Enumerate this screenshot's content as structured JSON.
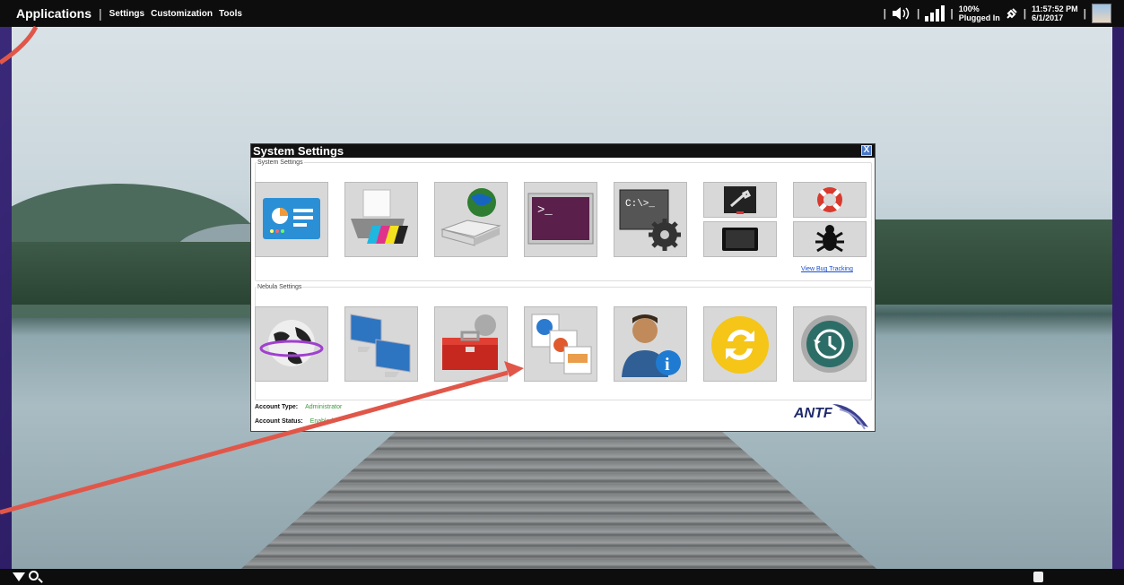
{
  "topbar": {
    "apps_label": "Applications",
    "separator": "|",
    "menu": [
      "Settings",
      "Customization",
      "Tools"
    ],
    "volume_icon": "speaker-icon",
    "battery_percent": "100%",
    "battery_status": "Plugged In",
    "time": "11:57:52 PM",
    "date": "6/1/2017"
  },
  "window": {
    "title": "System Settings",
    "close_label": "X",
    "system_group_label": "System Settings",
    "nebula_group_label": "Nebula Settings",
    "bug_link": "View Bug Tracking",
    "system_tiles": [
      "display-card-icon",
      "printer-icon",
      "network-router-icon",
      "terminal-icon",
      "command-gear-icon"
    ],
    "system_minis": [
      "tools-icon",
      "tablet-icon",
      "lifebuoy-icon",
      "bug-icon"
    ],
    "nebula_tiles": [
      "globe-icon",
      "computers-icon",
      "toolbox-icon",
      "files-icon",
      "user-info-icon",
      "sync-icon",
      "history-icon"
    ],
    "account_type_label": "Account Type:",
    "account_type_value": "Administrator",
    "account_status_label": "Account Status:",
    "account_status_value": "Enabled",
    "logo": "ANTF"
  },
  "colors": {
    "arrow": "#e0574a",
    "frame": "#2b1c63"
  }
}
